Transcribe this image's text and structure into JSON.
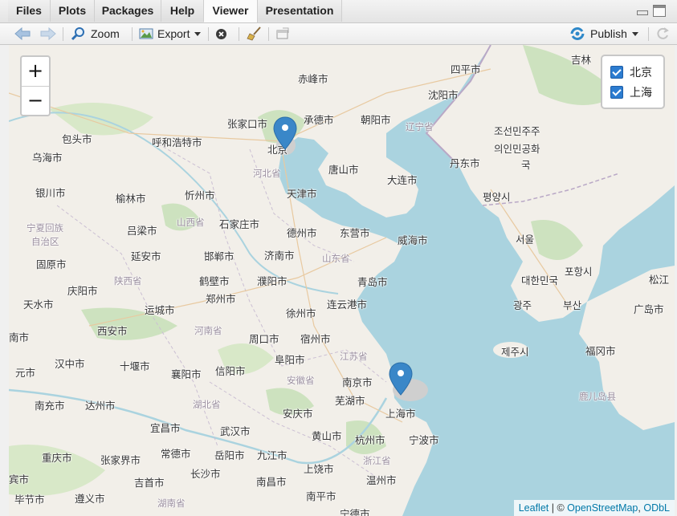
{
  "tabs": [
    {
      "label": "Files",
      "active": false
    },
    {
      "label": "Plots",
      "active": false
    },
    {
      "label": "Packages",
      "active": false
    },
    {
      "label": "Help",
      "active": false
    },
    {
      "label": "Viewer",
      "active": true
    },
    {
      "label": "Presentation",
      "active": false
    }
  ],
  "toolbar": {
    "zoom_label": "Zoom",
    "export_label": "Export",
    "publish_label": "Publish"
  },
  "map": {
    "zoom_in": "+",
    "zoom_out": "−",
    "layers": [
      {
        "label": "北京",
        "checked": true
      },
      {
        "label": "上海",
        "checked": true
      }
    ],
    "markers": [
      {
        "name": "北京"
      },
      {
        "name": "上海"
      }
    ],
    "marker_color": "#3a87c8",
    "attribution": {
      "leaflet": "Leaflet",
      "separator": " | © ",
      "osm": "OpenStreetMap",
      "sep2": ", ",
      "odbl": "ODbL"
    },
    "labels": [
      "赤峰市",
      "四平市",
      "吉林",
      "沈阳市",
      "张家口市",
      "承德市",
      "朝阳市",
      "辽宁省",
      "包头市",
      "呼和浩特市",
      "北京",
      "乌海市",
      "조선민주주",
      "의인민공화",
      "국",
      "河北省",
      "唐山市",
      "丹东市",
      "天津市",
      "大连市",
      "银川市",
      "榆林市",
      "忻州市",
      "평양시",
      "宁夏回族",
      "自治区",
      "山西省",
      "石家庄市",
      "吕梁市",
      "德州市",
      "东营市",
      "威海市",
      "서울",
      "固原市",
      "延安市",
      "邯郸市",
      "济南市",
      "山东省",
      "포항시",
      "대한민국",
      "庆阳市",
      "陕西省",
      "鹤壁市",
      "濮阳市",
      "青岛市",
      "松江",
      "天水市",
      "郑州市",
      "连云港市",
      "광주",
      "부산",
      "广岛市",
      "运城市",
      "徐州市",
      "西安市",
      "河南省",
      "宿州市",
      "福冈市",
      "南市",
      "周口市",
      "阜阳市",
      "江苏省",
      "汉中市",
      "十堰市",
      "襄阳市",
      "信阳市",
      "安徽省",
      "南京市",
      "제주시",
      "元市",
      "湖北省",
      "芜湖市",
      "上海市",
      "鹿儿岛县",
      "南充市",
      "达州市",
      "安庆市",
      "宜昌市",
      "武汉市",
      "黄山市",
      "杭州市",
      "宁波市",
      "重庆市",
      "常德市",
      "张家界市",
      "岳阳市",
      "九江市",
      "浙江省",
      "长沙市",
      "上饶市",
      "温州市",
      "吉首市",
      "南昌市",
      "宾市",
      "毕节市",
      "遵义市",
      "湖南省",
      "南平市",
      "宁德市"
    ]
  }
}
